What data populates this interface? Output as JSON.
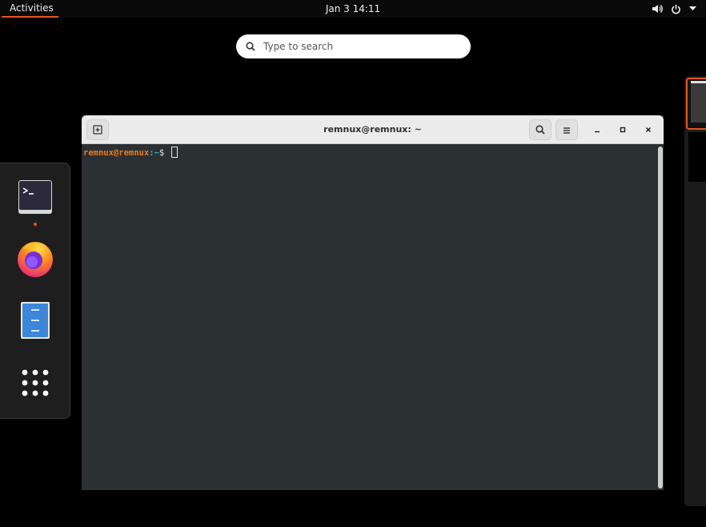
{
  "topbar": {
    "activities_label": "Activities",
    "clock": "Jan 3  14:11",
    "icons": [
      "volume-icon",
      "power-icon",
      "menu-arrow-icon"
    ]
  },
  "search": {
    "placeholder": "Type to search",
    "icon": "search-icon"
  },
  "dock": {
    "items": [
      {
        "name": "terminal",
        "icon": "terminal-icon",
        "running": true
      },
      {
        "name": "firefox",
        "icon": "firefox-icon",
        "running": false
      },
      {
        "name": "files",
        "icon": "files-icon",
        "running": false
      },
      {
        "name": "show-applications",
        "icon": "app-grid-icon",
        "running": false
      }
    ]
  },
  "terminal": {
    "title": "remnux@remnux: ~",
    "prompt_user": "remnux@remnux",
    "prompt_path": ":~",
    "prompt_symbol": "$",
    "buttons": [
      "new-tab",
      "search",
      "menu",
      "minimize",
      "maximize",
      "close"
    ]
  },
  "colors": {
    "accent": "#e95420",
    "terminal_bg": "#2b3032",
    "prompt_user": "#e87c20",
    "prompt_path": "#3daee9"
  }
}
